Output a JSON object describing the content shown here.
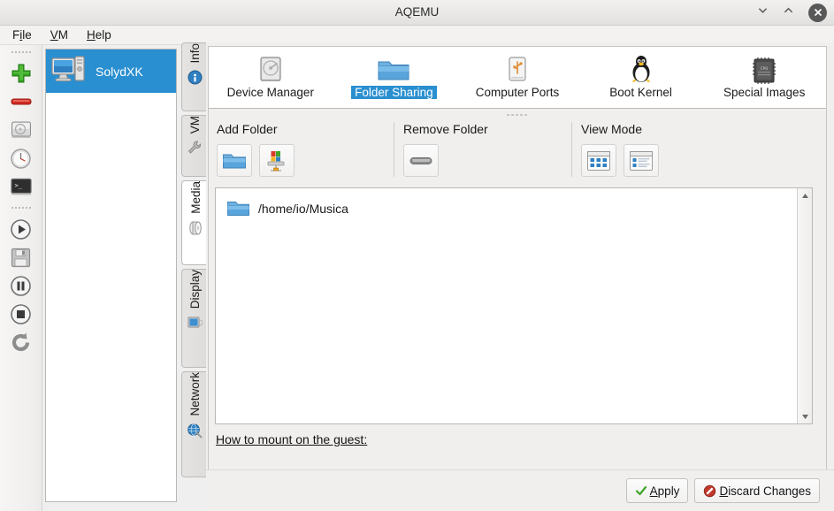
{
  "window": {
    "title": "AQEMU",
    "controls": [
      {
        "name": "minimize",
        "glyph": "minimize-icon"
      },
      {
        "name": "maximize",
        "glyph": "maximize-icon"
      },
      {
        "name": "close",
        "glyph": "close-icon"
      }
    ]
  },
  "menubar": {
    "items": [
      {
        "label": "File",
        "mnemonic_index": 1
      },
      {
        "label": "VM",
        "mnemonic_index": 0
      },
      {
        "label": "Help",
        "mnemonic_index": 0
      }
    ]
  },
  "left_toolbar": {
    "buttons": [
      {
        "name": "add-vm-button",
        "icon": "green-plus-icon",
        "tooltip": "Add VM"
      },
      {
        "name": "remove-vm-button",
        "icon": "red-minus-icon",
        "tooltip": "Remove VM"
      },
      {
        "name": "hard-disk-button",
        "icon": "hard-disk-icon",
        "tooltip": "Disk"
      },
      {
        "name": "clock-button",
        "icon": "clock-icon",
        "tooltip": "Clock"
      },
      {
        "name": "terminal-button",
        "icon": "terminal-icon",
        "tooltip": "Terminal"
      },
      {
        "name": "start-vm-button",
        "icon": "play-icon",
        "tooltip": "Start"
      },
      {
        "name": "save-vm-button",
        "icon": "floppy-save-icon",
        "tooltip": "Save"
      },
      {
        "name": "pause-vm-button",
        "icon": "pause-icon",
        "tooltip": "Pause"
      },
      {
        "name": "stop-vm-button",
        "icon": "stop-icon",
        "tooltip": "Stop"
      },
      {
        "name": "restart-vm-button",
        "icon": "restart-icon",
        "tooltip": "Restart"
      }
    ]
  },
  "vm_list": {
    "items": [
      {
        "label": "SolydXK",
        "icon": "computer-icon",
        "selected": true
      }
    ]
  },
  "side_tabs": {
    "items": [
      {
        "label": "Info",
        "icon": "info-icon",
        "selected": false
      },
      {
        "label": "VM",
        "icon": "tools-icon",
        "selected": false
      },
      {
        "label": "Media",
        "icon": "media-disc-icon",
        "selected": true
      },
      {
        "label": "Display",
        "icon": "monitor-icon",
        "selected": false
      },
      {
        "label": "Network",
        "icon": "network-globe-icon",
        "selected": false
      }
    ]
  },
  "main_toolbar": {
    "items": [
      {
        "label": "Device Manager",
        "icon": "hard-disk-icon",
        "selected": false
      },
      {
        "label": "Folder Sharing",
        "icon": "folder-icon",
        "selected": true
      },
      {
        "label": "Computer Ports",
        "icon": "usb-drive-icon",
        "selected": false
      },
      {
        "label": "Boot Kernel",
        "icon": "tux-penguin-icon",
        "selected": false
      },
      {
        "label": "Special Images",
        "icon": "chip-icon",
        "selected": false
      }
    ]
  },
  "groups": [
    {
      "title": "Add Folder",
      "buttons": [
        {
          "name": "add-local-folder-button",
          "icon": "folder-icon"
        },
        {
          "name": "add-network-share-button",
          "icon": "network-share-icon"
        }
      ]
    },
    {
      "title": "Remove Folder",
      "buttons": [
        {
          "name": "remove-folder-button",
          "icon": "remove-bar-icon"
        }
      ]
    },
    {
      "title": "View Mode",
      "buttons": [
        {
          "name": "icon-view-button",
          "icon": "grid-view-icon"
        },
        {
          "name": "list-view-button",
          "icon": "list-view-icon"
        }
      ]
    }
  ],
  "folder_list": {
    "rows": [
      {
        "path": "/home/io/Musica",
        "icon": "folder-icon"
      }
    ]
  },
  "howto_link": {
    "label": "How to mount on the guest:"
  },
  "bottom_buttons": [
    {
      "name": "apply-button",
      "label": "Apply",
      "icon": "green-check-icon",
      "mnemonic_index": 0
    },
    {
      "name": "discard-changes-button",
      "label": "Discard Changes",
      "icon": "red-forbidden-icon",
      "mnemonic_index": 0
    }
  ],
  "colors": {
    "selection_blue": "#2a8fd0",
    "window_bg": "#efefef",
    "panel_white": "#ffffff",
    "accent_green": "#3fa32a",
    "accent_red": "#c0392b"
  }
}
